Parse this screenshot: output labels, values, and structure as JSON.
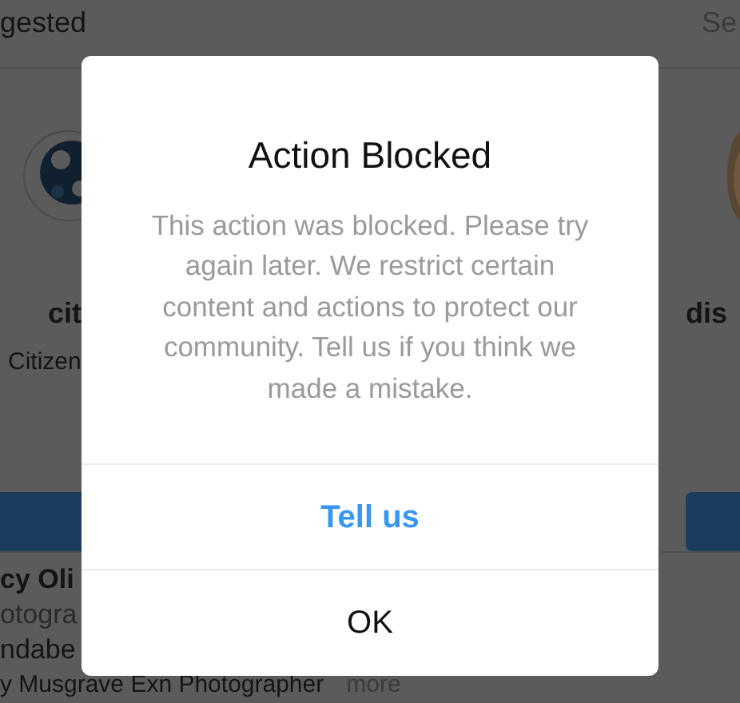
{
  "background": {
    "section_title": "gested",
    "see_all": "Se",
    "suggestions": [
      {
        "name": "cit",
        "subtitle": "Citizen"
      },
      {
        "name": "dis"
      }
    ],
    "post": {
      "name": "cy Oli",
      "lines": [
        "otogra",
        "ndabe"
      ],
      "caption": "y Musgrave Exn Photographer",
      "more": "more"
    }
  },
  "dialog": {
    "title": "Action Blocked",
    "message": "This action was blocked. Please try again later. We restrict certain content and actions to protect our community. Tell us if you think we made a mistake.",
    "buttons": [
      {
        "label": "Tell us",
        "kind": "primary"
      },
      {
        "label": "OK",
        "kind": "default"
      }
    ]
  }
}
